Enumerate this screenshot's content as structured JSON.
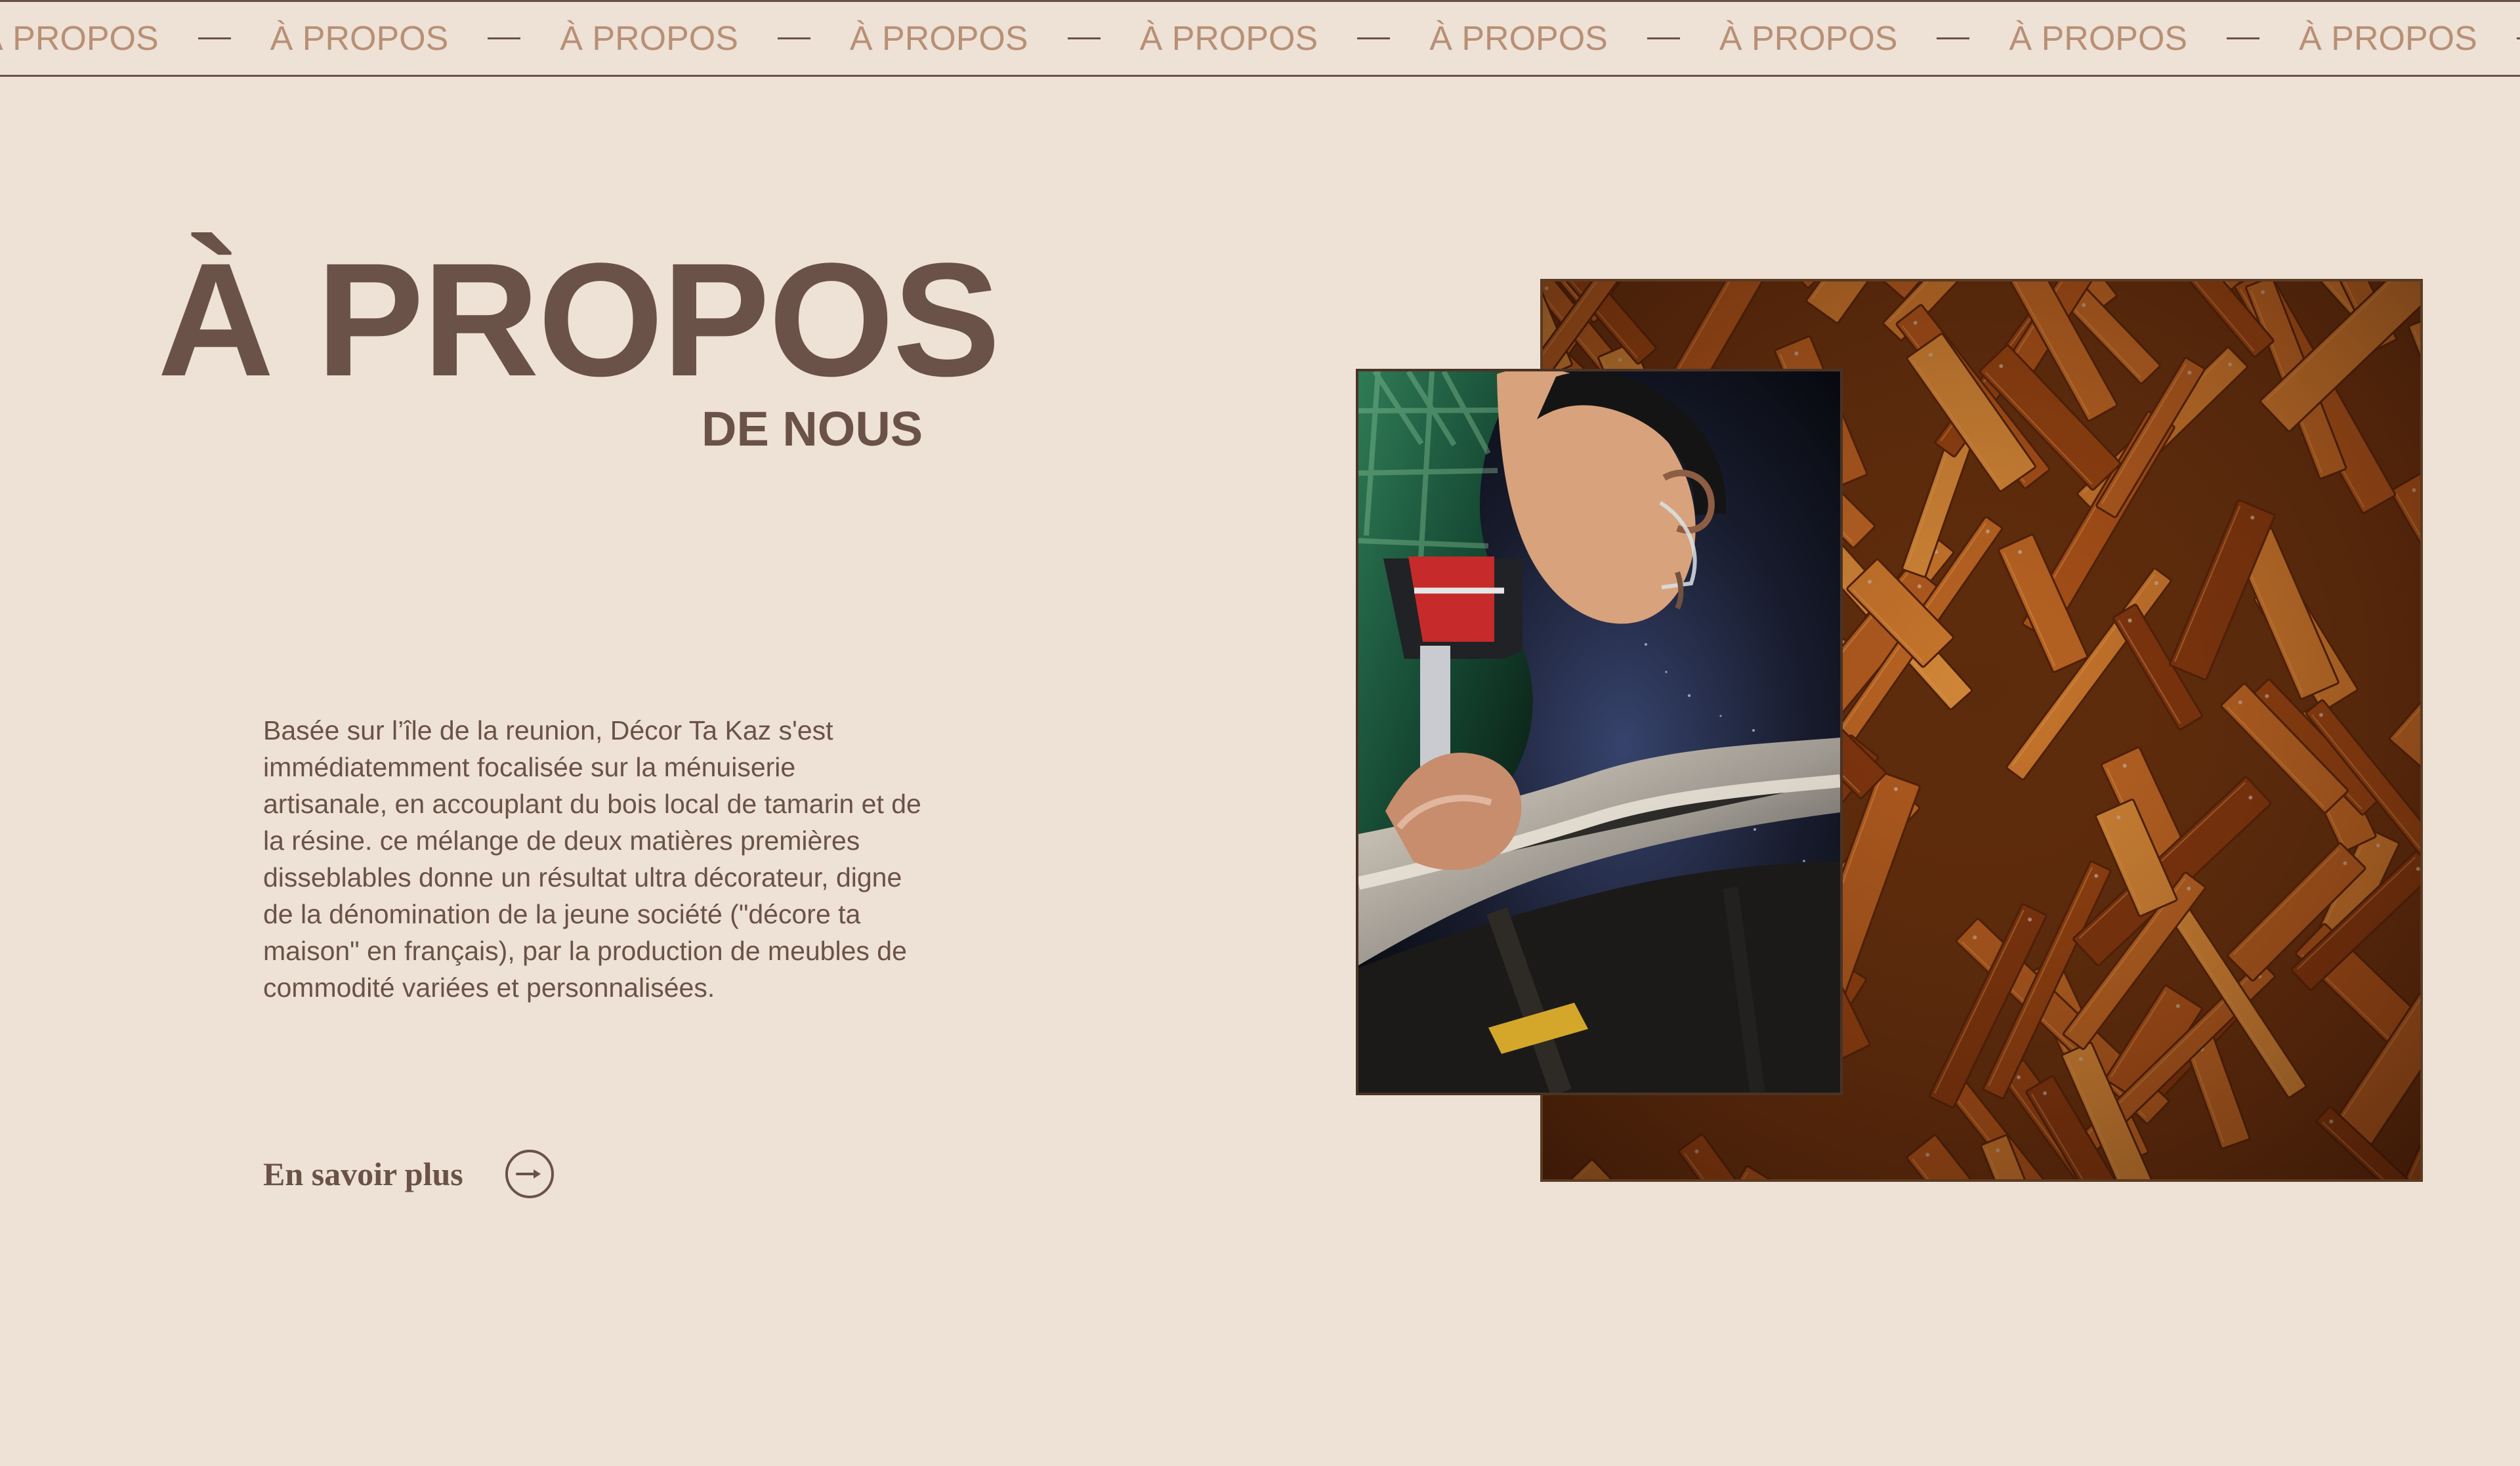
{
  "marquee": {
    "text": "À PROPOS",
    "repeat_count": 10
  },
  "about": {
    "title": "À PROPOS",
    "subtitle": "DE NOUS",
    "paragraph": "Basée sur l’île de la reunion, Décor Ta Kaz s'est immédiatemment focalisée sur la ménuiserie artisanale, en accouplant du bois local de tamarin et de la résine. ce mélange de deux matières premières disseblables donne un résultat ultra décorateur, digne de la dénomination de la jeune société (\"décore ta maison\" en français), par la production de meubles de commodité variées et personnalisées.",
    "cta_label": "En savoir plus"
  },
  "colors": {
    "background": "#EEE1D6",
    "brown": "#6A5248",
    "marquee_text": "#B89075",
    "wood": "#A65A1E"
  },
  "icons": {
    "arrow": "arrow-right-icon"
  }
}
